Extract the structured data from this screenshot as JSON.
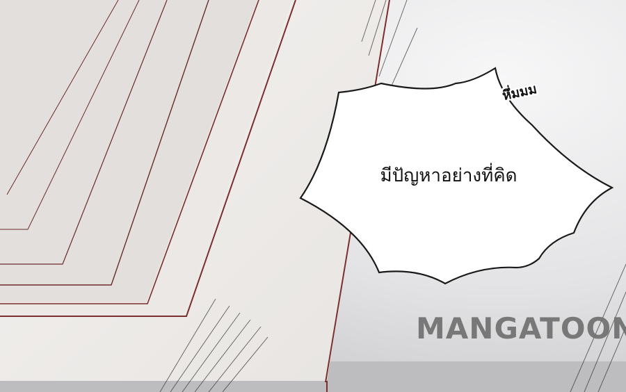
{
  "scene": {
    "sound_effect": "หึ่มมม",
    "speech_bubble_text": "มีปัญหาอย่างที่คิด",
    "watermark_text": "MANGATOON"
  },
  "colors": {
    "background": "#e9e9ea",
    "paper": "#f1efed",
    "paper_edge": "#7a2e2e",
    "bubble_fill": "#ffffff",
    "bubble_stroke": "#1a1a1a",
    "watermark": "#6e6e6e"
  }
}
